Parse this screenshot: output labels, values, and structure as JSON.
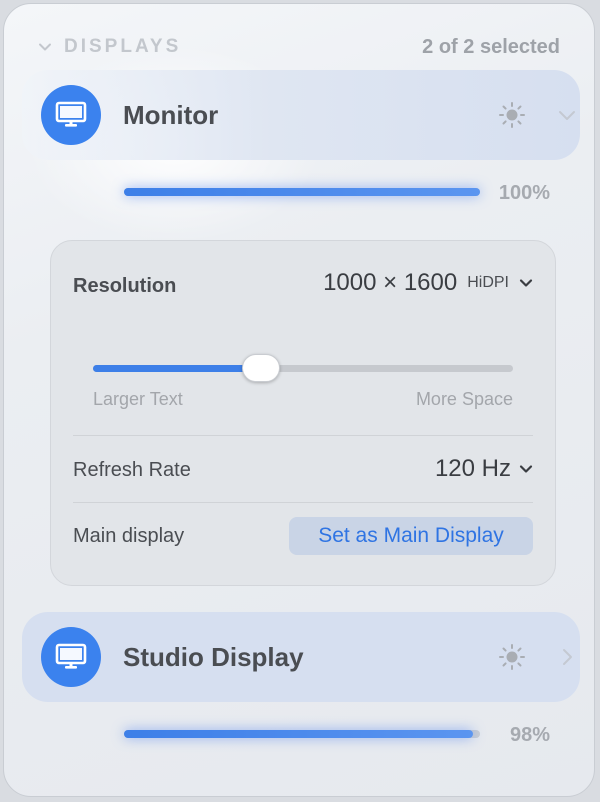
{
  "section": {
    "title": "DISPLAYS",
    "count": "2 of 2 selected"
  },
  "displays": [
    {
      "name": "Monitor",
      "brightness_label": "100%",
      "brightness": 1.0,
      "expanded": true
    },
    {
      "name": "Studio Display",
      "brightness_label": "98%",
      "brightness": 0.98,
      "expanded": false
    }
  ],
  "settings": {
    "resolution_label": "Resolution",
    "resolution_value": "1000 × 1600",
    "resolution_badge": "HiDPI",
    "scale_position": 0.4,
    "scale_left_label": "Larger Text",
    "scale_right_label": "More Space",
    "refresh_label": "Refresh Rate",
    "refresh_value": "120 Hz",
    "main_label": "Main display",
    "main_button": "Set as Main Display"
  },
  "colors": {
    "accent": "#3b82ee",
    "button_bg": "#c9d4e6",
    "button_text": "#2f74e3"
  },
  "icons": {
    "display": "display-icon",
    "brightness": "sun-icon",
    "expand": "chevron-down-icon",
    "collapse": "chevron-right-icon"
  }
}
